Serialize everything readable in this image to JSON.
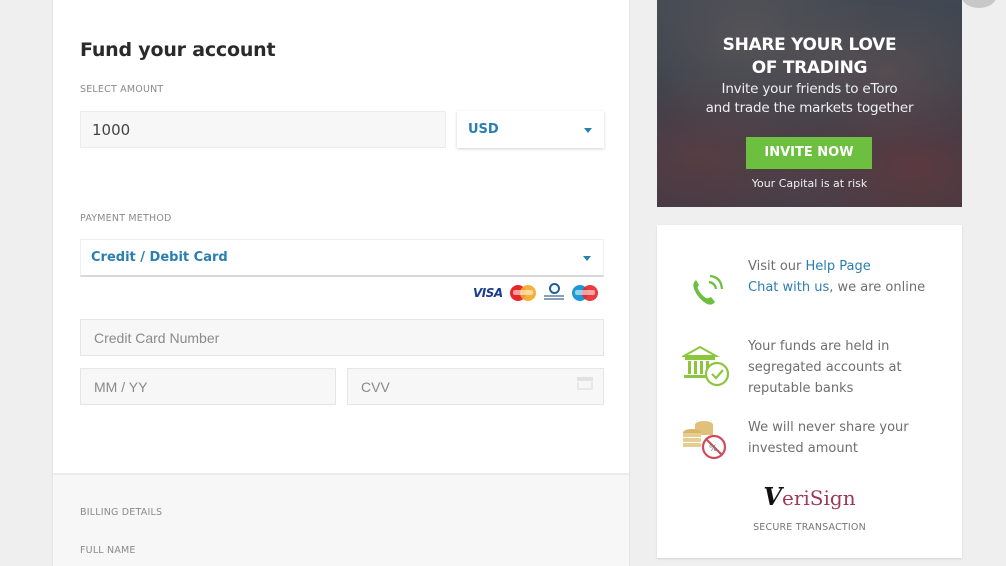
{
  "form": {
    "title": "Fund your account",
    "amount_label": "SELECT AMOUNT",
    "amount_value": "1000",
    "currency": {
      "selected": "USD",
      "icon": "chevron-down-icon"
    },
    "payment_label": "PAYMENT METHOD",
    "payment_method": {
      "selected": "Credit / Debit Card",
      "icon": "chevron-down-icon"
    },
    "card_brands": [
      "VISA",
      "MasterCard",
      "Diners Club International",
      "Maestro"
    ],
    "card_number_placeholder": "Credit Card Number",
    "expiry_placeholder": "MM / YY",
    "cvv_placeholder": "CVV",
    "billing_label": "BILLING DETAILS",
    "full_name_label": "FULL NAME"
  },
  "banner": {
    "headline_line1": "SHARE YOUR LOVE",
    "headline_line2": "OF TRADING",
    "sub_line1": "Invite your friends to eToro",
    "sub_line2": "and trade the markets together",
    "cta": "INVITE NOW",
    "risk": "Your Capital is at risk",
    "cta_color": "#6cbf3f"
  },
  "trust": {
    "help": {
      "prefix": "Visit our ",
      "help_link": "Help Page",
      "chat_link": "Chat with us",
      "suffix": ", we are online",
      "icon": "phone-icon"
    },
    "funds": {
      "text": "Your funds are held in segregated accounts at reputable banks",
      "icon": "bank-check-icon"
    },
    "privacy": {
      "text": "We will never share your invested amount",
      "icon": "coins-no-share-icon"
    },
    "seal_v": "V",
    "seal_rest": "eriSign",
    "secure_label": "SECURE TRANSACTION"
  },
  "colors": {
    "accent": "#2a7fb0",
    "green": "#6cbf3f",
    "background": "#efefef"
  }
}
